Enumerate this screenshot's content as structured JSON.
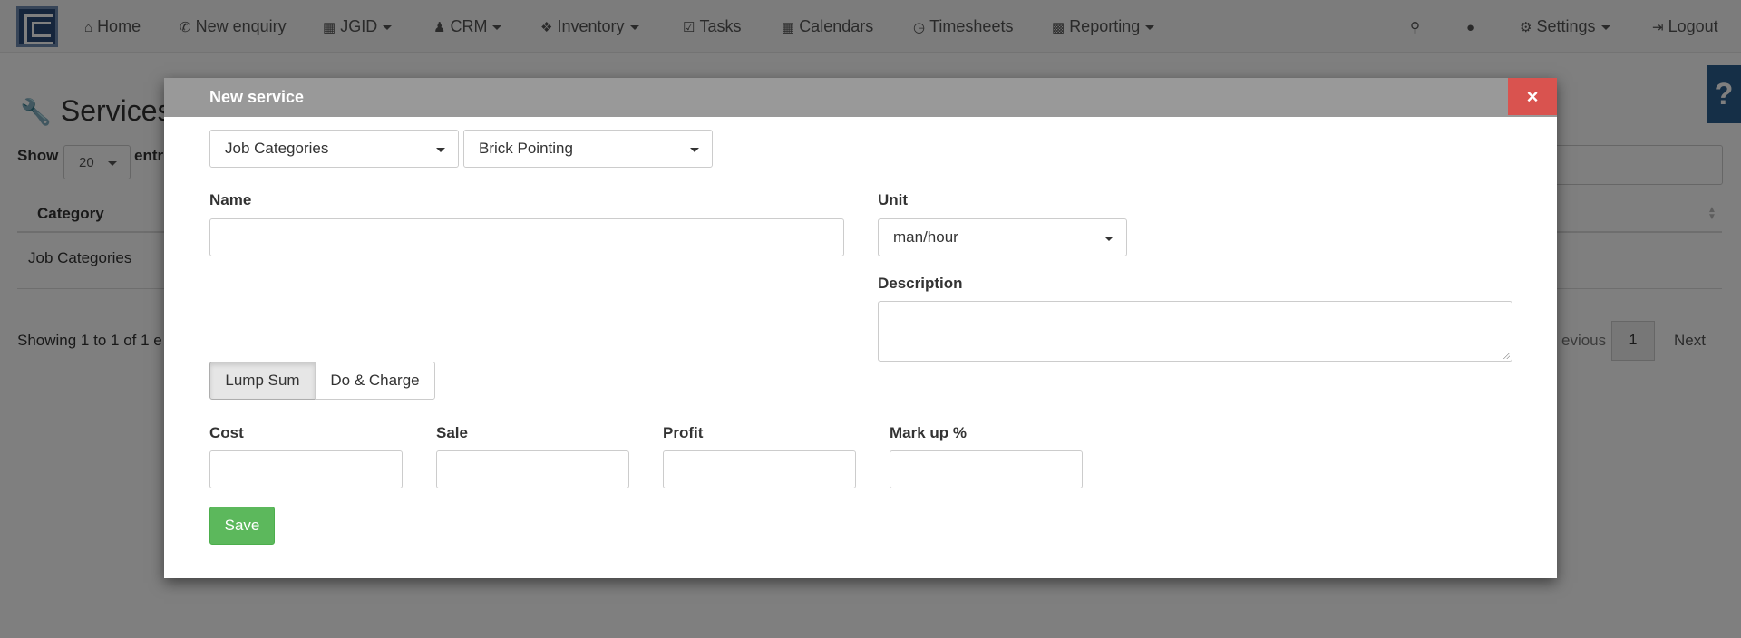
{
  "nav": {
    "home": "Home",
    "new_enquiry": "New enquiry",
    "jgid": "JGID",
    "crm": "CRM",
    "inventory": "Inventory",
    "tasks": "Tasks",
    "calendars": "Calendars",
    "timesheets": "Timesheets",
    "reporting": "Reporting",
    "settings": "Settings",
    "logout": "Logout"
  },
  "page": {
    "title": "Services",
    "show_label": "Show",
    "page_size": "20",
    "entries_label_partial": "entr",
    "help": "?",
    "table": {
      "headers": [
        "Category"
      ],
      "rows": [
        [
          "Job Categories"
        ]
      ]
    },
    "showing_partial": "Showing 1 to 1 of 1 e",
    "pagination": {
      "previous_partial": "evious",
      "current": "1",
      "next": "Next"
    }
  },
  "modal": {
    "title": "New service",
    "close": "×",
    "category_select": "Job Categories",
    "subcategory_select": "Brick Pointing",
    "name_label": "Name",
    "name_value": "",
    "unit_label": "Unit",
    "unit_value": "man/hour",
    "description_label": "Description",
    "description_value": "",
    "pricing_modes": [
      "Lump Sum",
      "Do & Charge"
    ],
    "active_pricing_mode": "Lump Sum",
    "cost_label": "Cost",
    "sale_label": "Sale",
    "profit_label": "Profit",
    "markup_label": "Mark up %",
    "save_label": "Save"
  },
  "colors": {
    "overlay": "rgba(0,0,0,0.5)",
    "modal_header": "#999999",
    "close_button": "#d9534f",
    "save_button": "#5cb85c",
    "logo": "#2b4b78",
    "help_tab": "#2b5f8f"
  }
}
